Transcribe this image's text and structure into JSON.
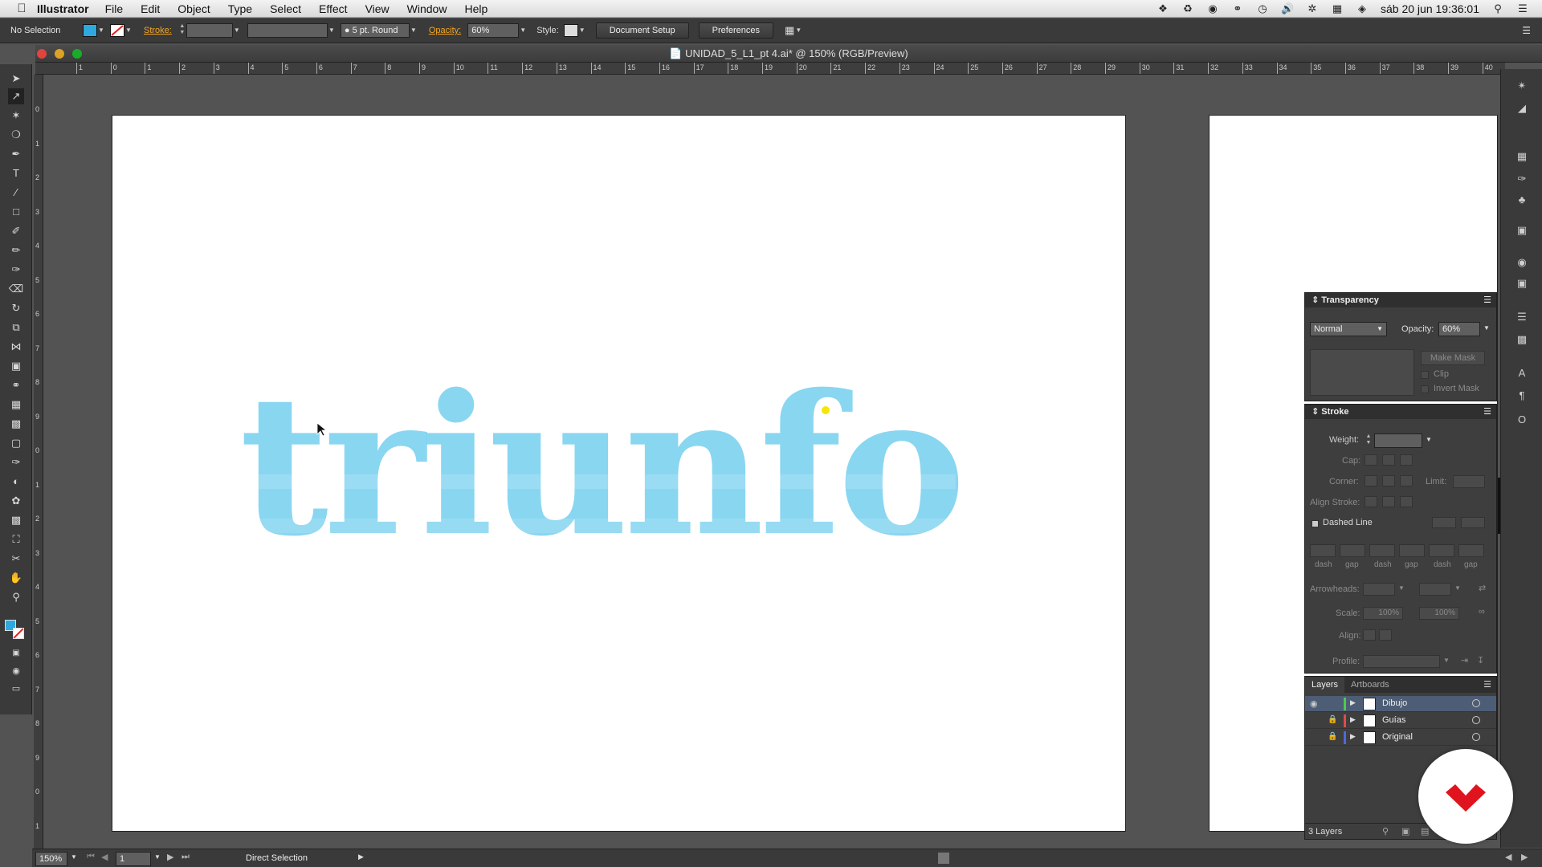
{
  "menubar": {
    "app_name": "Illustrator",
    "items": [
      "File",
      "Edit",
      "Object",
      "Type",
      "Select",
      "Effect",
      "View",
      "Window",
      "Help"
    ],
    "clock": "sáb 20 jun  19:36:01"
  },
  "controlbar": {
    "selection_label": "No Selection",
    "stroke_label": "Stroke:",
    "brush_value": "5 pt. Round",
    "opacity_label": "Opacity:",
    "opacity_value": "60%",
    "style_label": "Style:",
    "document_setup": "Document Setup",
    "preferences": "Preferences"
  },
  "document": {
    "title": "UNIDAD_5_L1_pt 4.ai* @ 150% (RGB/Preview)",
    "artwork_text": "triunfo",
    "artwork_color": "#3bbbe8"
  },
  "ruler": {
    "top_ticks": [
      "1",
      "0",
      "1",
      "2",
      "3",
      "4",
      "5",
      "6",
      "7",
      "8",
      "9",
      "10",
      "11",
      "12",
      "13",
      "14",
      "15",
      "16",
      "17",
      "18",
      "19",
      "20",
      "21",
      "22",
      "23",
      "24",
      "25",
      "26",
      "27",
      "28",
      "29",
      "30",
      "31",
      "32",
      "33",
      "34",
      "35",
      "36",
      "37",
      "38",
      "39",
      "40",
      "41"
    ],
    "left_ticks": [
      "0",
      "1",
      "2",
      "3",
      "4",
      "5",
      "6",
      "7",
      "8",
      "9",
      "0",
      "1",
      "2",
      "3",
      "4",
      "5",
      "6",
      "7",
      "8",
      "9",
      "0",
      "1",
      "2"
    ]
  },
  "transparency": {
    "title": "Transparency",
    "blend_mode": "Normal",
    "opacity_label": "Opacity:",
    "opacity_value": "60%",
    "make_mask": "Make Mask",
    "clip": "Clip",
    "invert_mask": "Invert Mask"
  },
  "stroke": {
    "title": "Stroke",
    "weight": "Weight:",
    "cap": "Cap:",
    "corner": "Corner:",
    "limit": "Limit:",
    "align_stroke": "Align Stroke:",
    "dashed_line": "Dashed Line",
    "dash_labels": [
      "dash",
      "gap",
      "dash",
      "gap",
      "dash",
      "gap"
    ],
    "arrowheads": "Arrowheads:",
    "scale": "Scale:",
    "scale_1": "100%",
    "scale_2": "100%",
    "align": "Align:",
    "profile": "Profile:"
  },
  "layers": {
    "tab_layers": "Layers",
    "tab_artboards": "Artboards",
    "rows": [
      {
        "name": "Dibujo",
        "color": "#4fc94f"
      },
      {
        "name": "Guías",
        "color": "#e04a4a"
      },
      {
        "name": "Original",
        "color": "#4a6ae0"
      }
    ],
    "count": "3 Layers"
  },
  "statusbar": {
    "zoom": "150%",
    "page": "1",
    "tool": "Direct Selection"
  }
}
